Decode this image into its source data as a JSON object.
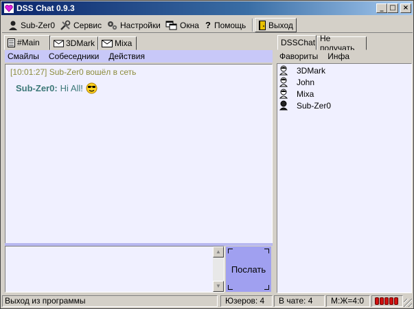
{
  "window": {
    "title": "DSS Chat 0.9.3",
    "minimize": "_",
    "maximize": "□",
    "close": "×"
  },
  "toolbar": {
    "items": [
      {
        "label": "Sub-Zer0",
        "icon": "user-icon"
      },
      {
        "label": "Сервис",
        "icon": "tools-icon"
      },
      {
        "label": "Настройки",
        "icon": "settings-icon"
      },
      {
        "label": "Окна",
        "icon": "windows-icon"
      },
      {
        "label": "Помощь",
        "icon": "help-icon"
      },
      {
        "label": "Выход",
        "icon": "exit-door-icon"
      }
    ],
    "help_glyph": "?"
  },
  "chat_tabs": [
    {
      "label": "#Main",
      "icon": "channel-icon",
      "active": true
    },
    {
      "label": "3DMark",
      "icon": "envelope-icon",
      "active": false
    },
    {
      "label": "Mixa",
      "icon": "envelope-icon",
      "active": false
    }
  ],
  "chat_menu": [
    "Смайлы",
    "Собеседники",
    "Действия"
  ],
  "messages": [
    {
      "type": "system",
      "text": "[10:01:27] Sub-Zer0 вошёл в сеть"
    },
    {
      "type": "message",
      "nick": "Sub-Zer0:",
      "text": "Hi All!",
      "emoticon": "cool-smiley-icon"
    }
  ],
  "input": {
    "value": "",
    "send_label": "Послать"
  },
  "right_tabs": [
    {
      "label": "DSSChat",
      "active": true
    },
    {
      "label": "Не получать",
      "active": false
    }
  ],
  "users_menu": [
    "Фавориты",
    "Инфа"
  ],
  "users": [
    {
      "name": "3DMark",
      "icon": "user-away-icon"
    },
    {
      "name": "John",
      "icon": "user-away-icon"
    },
    {
      "name": "Mixa",
      "icon": "user-away-icon"
    },
    {
      "name": "Sub-Zer0",
      "icon": "user-online-icon"
    }
  ],
  "status": {
    "hint": "Выход из программы",
    "users_count": "Юзеров: 4",
    "in_chat": "В чате: 4",
    "ratio": "М:Ж=4:0",
    "led_color": "#d01010"
  }
}
